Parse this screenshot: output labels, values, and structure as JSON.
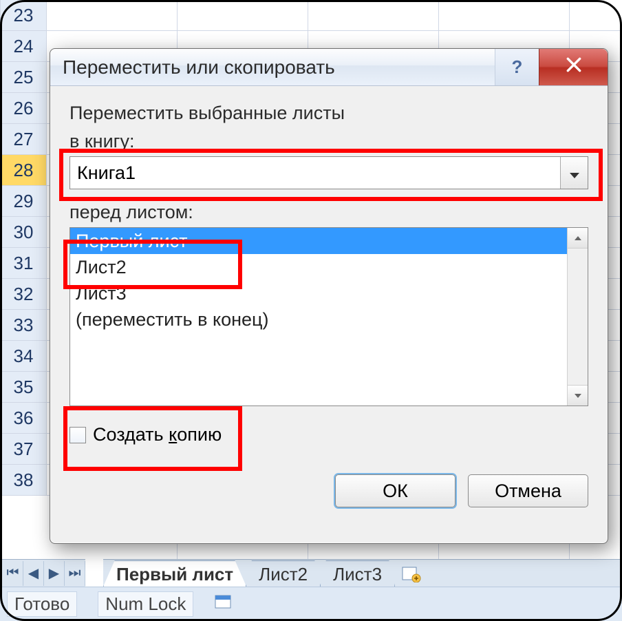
{
  "spreadsheet": {
    "row_numbers": [
      "23",
      "24",
      "25",
      "26",
      "27",
      "28",
      "29",
      "30",
      "31",
      "32",
      "33",
      "34",
      "35",
      "36",
      "37",
      "38"
    ],
    "selected_row": "28",
    "tabs": [
      "Первый лист",
      "Лист2",
      "Лист3"
    ],
    "status_ready": "Готово",
    "status_numlock": "Num Lock"
  },
  "dialog": {
    "title": "Переместить или скопировать",
    "label_move_selected": "Переместить выбранные листы",
    "label_to_book": "в книгу:",
    "book_value": "Книга1",
    "label_before_sheet": "перед листом:",
    "list": [
      "Первый лист",
      "Лист2",
      "Лист3",
      "(переместить в конец)"
    ],
    "selected_index": 0,
    "checkbox_label": "Создать копию",
    "ok": "ОК",
    "cancel": "Отмена"
  }
}
